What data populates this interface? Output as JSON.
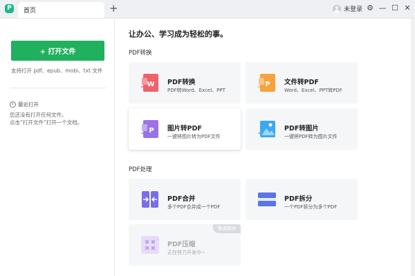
{
  "titlebar": {
    "logo_letter": "P",
    "tab_label": "首页",
    "add_tab": "+",
    "user_label": "未登录",
    "settings_glyph": "⚙",
    "minimize_glyph": "—",
    "maximize_glyph": "☐",
    "close_glyph": "✕"
  },
  "sidebar": {
    "open_button_label": "+ 打开文件",
    "supported_formats": "支持打开 pdf、epub、mobi、txt 文件",
    "recent_label": "最近打开",
    "empty_line1": "您还没有打开任何文件。",
    "empty_line2": "点击“打开文件”打开一个文档。"
  },
  "main": {
    "headline": "让办公、学习成为轻松的事。",
    "section_convert": "PDF转换",
    "section_process": "PDF处理",
    "cards": [
      {
        "title": "PDF转换",
        "subtitle": "PDF转Word、Excel、PPT",
        "icon": "pdf-to-word-icon",
        "color": "#f0616a"
      },
      {
        "title": "文件转PDF",
        "subtitle": "Word、Excel、PPT转PDF",
        "icon": "file-to-pdf-icon",
        "color": "#f7a23b"
      },
      {
        "title": "图片转PDF",
        "subtitle": "一键将图片转为PDF文件",
        "icon": "image-to-pdf-icon",
        "color": "#9a72e6"
      },
      {
        "title": "PDF转图片",
        "subtitle": "一键将PDF转为图片文件",
        "icon": "pdf-to-image-icon",
        "color": "#3aa9ef"
      },
      {
        "title": "PDF合并",
        "subtitle": "多个PDF合并成一个PDF",
        "icon": "pdf-merge-icon",
        "color": "#7a6ee8"
      },
      {
        "title": "PDF拆分",
        "subtitle": "一个PDF拆分为多个PDF",
        "icon": "pdf-split-icon",
        "color": "#5b74e6"
      },
      {
        "title": "PDF压缩",
        "subtitle": "正在努力开发中~",
        "icon": "pdf-compress-icon",
        "color": "#c9b8f2",
        "badge": "敬请期待"
      }
    ]
  }
}
